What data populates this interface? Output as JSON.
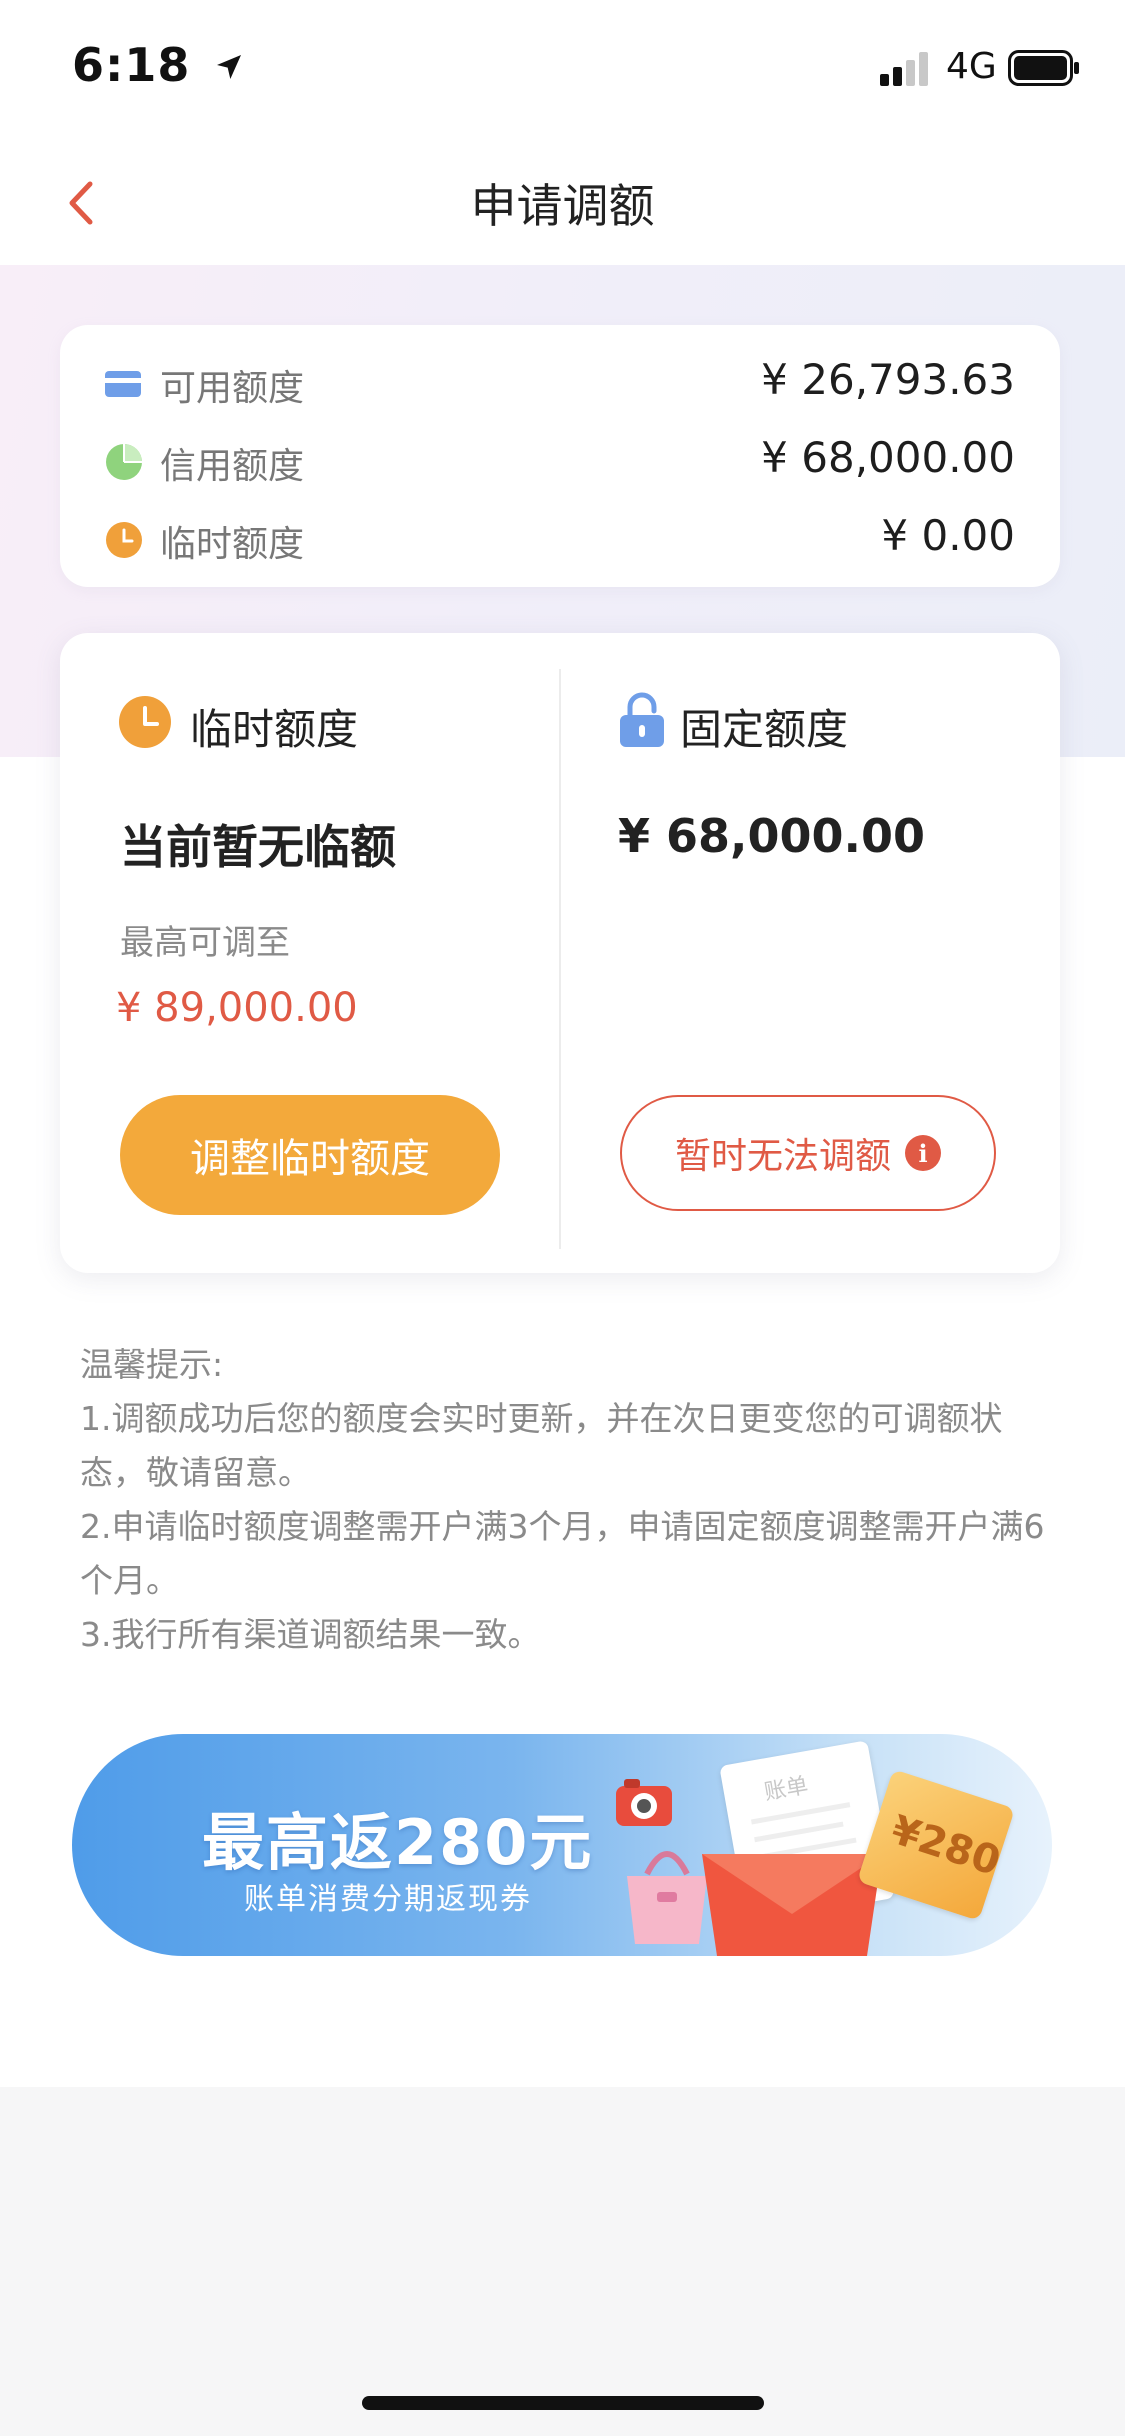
{
  "status_bar": {
    "time": "6:18",
    "network": "4G"
  },
  "nav": {
    "title": "申请调额"
  },
  "summary": {
    "available": {
      "label": "可用额度",
      "value": "¥ 26,793.63"
    },
    "credit": {
      "label": "信用额度",
      "value": "¥ 68,000.00"
    },
    "temporary": {
      "label": "临时额度",
      "value": "¥ 0.00"
    }
  },
  "temp_column": {
    "title": "临时额度",
    "status": "当前暂无临额",
    "max_label": "最高可调至",
    "max_value": "¥ 89,000.00",
    "button": "调整临时额度"
  },
  "fixed_column": {
    "title": "固定额度",
    "value": "¥ 68,000.00",
    "button": "暂时无法调额"
  },
  "tips": {
    "heading": "温馨提示:",
    "lines": [
      "1.调额成功后您的额度会实时更新，并在次日更变您的可调额状态，敬请留意。",
      "2.申请临时额度调整需开户满3个月，申请固定额度调整需开户满6个月。",
      "3.我行所有渠道调额结果一致。"
    ]
  },
  "banner": {
    "title": "最高返280元",
    "subtitle": "账单消费分期返现券",
    "bill_text": "账单",
    "coupon_text": "¥280"
  },
  "colors": {
    "accent_red": "#e05a45",
    "button_orange": "#f3a93b",
    "icon_orange": "#f0a03a",
    "icon_green": "#8fd37d",
    "icon_blue": "#6f9ee8"
  },
  "icons": {
    "back": "chevron-left-icon",
    "available": "card-icon",
    "credit": "pie-icon",
    "temporary": "clock-icon",
    "fixed": "lock-icon",
    "info": "info-icon"
  }
}
